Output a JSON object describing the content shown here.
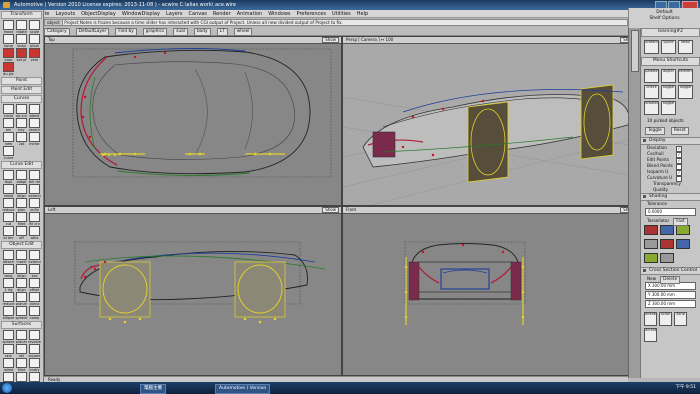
{
  "window": {
    "title": "Automotive ( Version 2010   License expires: 2013-11-08 ) - acwire C:\\alias work\\ ace.wire"
  },
  "menu": [
    "File",
    "Edit",
    "Delete",
    "Layouts",
    "ObjectDisplay",
    "WindowDisplay",
    "Layers",
    "Canvas",
    "Render",
    "Animation",
    "Windows",
    "Preferences",
    "Utilities",
    "Help"
  ],
  "prompt": {
    "snap_label": "object",
    "text": "Project Notes is frozen because a time slider has interacted with CGI output of Project. Unless all new divided output of Project to fix."
  },
  "top_right": {
    "line1": "Default",
    "line2": "Shelf Options"
  },
  "toolbar": {
    "category_label": "Category",
    "items": [
      "DefaultLayer",
      "Find by",
      "graphics",
      "sual",
      "body",
      "L7",
      "wheel"
    ]
  },
  "palette": {
    "transform": {
      "title": "Transform",
      "tools": [
        "move",
        "rotate",
        "scale",
        "nonp",
        "snap",
        "pivot",
        "prop",
        "set pl",
        "zero",
        "du plc"
      ]
    },
    "paint_label": "Paint",
    "paint_edit": {
      "title": "Paint Edit"
    },
    "curves": {
      "title": "Curves",
      "tools": [
        "circle",
        "ep crv",
        "blend",
        "arc",
        "key",
        "sketch",
        "new",
        "2pt",
        "mirror",
        "curve"
      ]
    },
    "curve_edit": {
      "title": "Curve Edit",
      "tools": [
        "dupl",
        "adapt",
        "brk ref",
        "rebld",
        "align",
        "extend",
        "reduce",
        "plan",
        "unfin",
        "cut",
        "fillet",
        "fill crv",
        "bl drv",
        "off",
        "oths"
      ]
    },
    "object_edit": {
      "title": "Object Edit",
      "tools": [
        "attach",
        "insert",
        "extend",
        "tang",
        "align",
        "pro",
        "1 rig",
        "align",
        "offset",
        "reduce",
        "planar",
        "xtend",
        "ellipse",
        "sphere",
        "comp"
      ]
    },
    "surfaces": {
      "title": "Surfaces",
      "tools": [
        "sphere",
        "planar",
        "revolve",
        "skin",
        "rail",
        "square",
        "rolled",
        "fillet",
        "bndry",
        "round",
        "profile",
        "offset"
      ]
    }
  },
  "viewports": [
    {
      "name": "Top",
      "button": "Show"
    },
    {
      "name": "Persp [ Camera ] ↔ 100",
      "button": "Show"
    },
    {
      "name": "Left",
      "button": "Show"
    },
    {
      "name": "Front",
      "button": "Show"
    }
  ],
  "right_panel": {
    "tabs": [
      "learning#2"
    ],
    "shelf_items": [
      "Stream",
      "Splinc",
      "keep"
    ],
    "menu_shortcuts_label": "Menu Shortcuts",
    "shortcut_items": [
      "palette",
      "object",
      "reference",
      "check",
      "toggle",
      "toggle",
      "unselect",
      "toggle"
    ],
    "picked_label": "10 picked objects",
    "buttons": [
      "Toggle",
      "Reset"
    ],
    "display": {
      "title": "Display",
      "rows": [
        {
          "label": "Deviation",
          "checked": true
        },
        {
          "label": "Cvs/hull",
          "checked": true
        },
        {
          "label": "Edit Points",
          "checked": true
        },
        {
          "label": "Blend Points",
          "checked": false
        },
        {
          "label": "Isoparm U",
          "checked": true
        },
        {
          "label": "Curvature U",
          "checked": false
        }
      ],
      "sub": [
        "Transparency",
        "Quality"
      ]
    },
    "shading": {
      "title": "Shading",
      "tolerance_label": "Tolerance",
      "tolerance_value": "0.0000",
      "tessellator_label": "Tessellator",
      "tessellator_value": "Fast"
    },
    "cross_section": {
      "title": "Cross Section Control",
      "new_label": "New",
      "delete_label": "Delete",
      "fields": [
        "X  300.00 mm",
        "Y  300.00 mm",
        "Z  300.00 mm"
      ]
    },
    "bottom_tools": [
      "Interact",
      "Xcroll",
      "Xshp",
      "Xcurve"
    ]
  },
  "status": {
    "text": "Ready"
  },
  "taskbar": {
    "items": [
      "電腦主機",
      "Automotive ( Version"
    ],
    "clock": "下午 9:51"
  },
  "colors": {
    "title_bg": "#1d3a5f",
    "viewport_bg": "#878787",
    "panel_bg": "#c6c6c6"
  }
}
